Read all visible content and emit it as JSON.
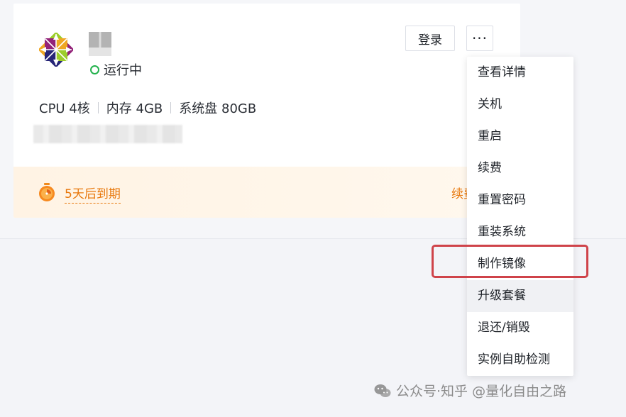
{
  "status": {
    "text": "运行中",
    "color": "#22b14c"
  },
  "specs": [
    {
      "label": "CPU 4核"
    },
    {
      "label": "内存 4GB"
    },
    {
      "label": "系统盘 80GB"
    }
  ],
  "expiry": {
    "text": "5天后到期",
    "renew_label": "续费",
    "accent": "#e8780c"
  },
  "actions": {
    "login_label": "登录",
    "more_label": "···"
  },
  "menu": {
    "items": [
      {
        "label": "查看详情"
      },
      {
        "label": "关机"
      },
      {
        "label": "重启"
      },
      {
        "label": "续费"
      },
      {
        "label": "重置密码"
      },
      {
        "label": "重装系统"
      },
      {
        "label": "制作镜像"
      },
      {
        "label": "升级套餐"
      },
      {
        "label": "退还/销毁"
      },
      {
        "label": "实例自助检测"
      }
    ],
    "hovered_index": 7,
    "highlighted_index": 6
  },
  "watermark": {
    "text": "公众号·知乎 @量化自由之路"
  }
}
